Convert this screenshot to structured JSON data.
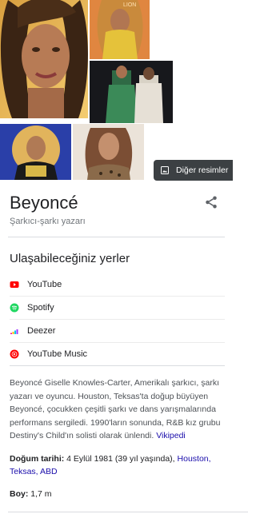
{
  "images": {
    "more_images_label": "Diğer resimler"
  },
  "entity": {
    "title": "Beyoncé",
    "subtitle": "Şarkıcı-şarkı yazarı"
  },
  "listen": {
    "title": "Ulaşabileceğiniz yerler",
    "services": [
      {
        "label": "YouTube",
        "icon": "youtube-icon",
        "color": "#ff0000"
      },
      {
        "label": "Spotify",
        "icon": "spotify-icon",
        "color": "#1ed760"
      },
      {
        "label": "Deezer",
        "icon": "deezer-icon",
        "color": "#ff8a00"
      },
      {
        "label": "YouTube Music",
        "icon": "youtube-music-icon",
        "color": "#ff0000"
      }
    ]
  },
  "description": {
    "text": "Beyoncé Giselle Knowles-Carter, Amerikalı şarkıcı, şarkı yazarı ve oyuncu. Houston, Teksas'ta doğup büyüyen Beyoncé, çocukken çeşitli şarkı ve dans yarışmalarında performans sergiledi. 1990'ların sonunda, R&B kız grubu Destiny's Child'ın solisti olarak ünlendi.",
    "source_link": "Vikipedi"
  },
  "facts": {
    "birth": {
      "label": "Doğum tarihi:",
      "value": "4 Eylül 1981 (39 yıl yaşında),",
      "place_link_1": "Houston,",
      "place_link_2": "Teksas,",
      "place_link_3": "ABD"
    },
    "height": {
      "label": "Boy:",
      "value": "1,7 m"
    }
  },
  "colors": {
    "link": "#1a0dab",
    "text": "#202124",
    "secondary_text": "#70757a",
    "divider": "#dadce0"
  }
}
